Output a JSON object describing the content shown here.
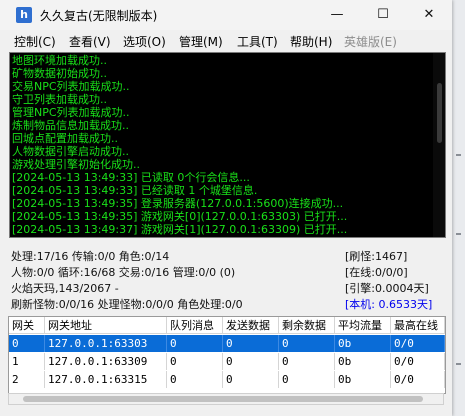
{
  "window": {
    "title": "久久复古(无限制版本)",
    "icon_letter": "h",
    "minimize_glyph": "—",
    "maximize_glyph": "☐",
    "close_glyph": "✕"
  },
  "menu": [
    {
      "label": "控制(C)",
      "enabled": true
    },
    {
      "label": "查看(V)",
      "enabled": true
    },
    {
      "label": "选项(O)",
      "enabled": true
    },
    {
      "label": "管理(M)",
      "enabled": true
    },
    {
      "label": "工具(T)",
      "enabled": true
    },
    {
      "label": "帮助(H)",
      "enabled": true
    },
    {
      "label": "英雄版(E)",
      "enabled": false
    }
  ],
  "log": [
    "地图环境加载成功..",
    "矿物数据初始成功..",
    "交易NPC列表加载成功..",
    "守卫列表加载成功..",
    "管理NPC列表加载成功..",
    "炼制物品信息加载成功..",
    "回城点配置加载成功..",
    "人物数据引擎启动成功..",
    "游戏处理引擎初始化成功..",
    "[2024-05-13 13:49:33] 已读取 0个行会信息...",
    "[2024-05-13 13:49:33] 已经读取 1 个城堡信息.",
    "[2024-05-13 13:49:35] 登录服务器(127.0.0.1:5600)连接成功...",
    "[2024-05-13 13:49:35] 游戏网关[0](127.0.0.1:63303) 已打开...",
    "[2024-05-13 13:49:37] 游戏网关[1](127.0.0.1:63309) 已打开..."
  ],
  "stats": {
    "line1": "处理:17/16 传输:0/0 角色:0/14",
    "line2": "人物:0/0 循环:16/68 交易:0/16 管理:0/0 (0)",
    "line3": "火焰天玛,143/2067 -",
    "line4": "刷新怪物:0/0/16 处理怪物:0/0/0 角色处理:0/0",
    "right1": "[刷怪:1467]",
    "right2": "[在线:0/0/0]",
    "right3": "[引擎:0.0004天]",
    "right4": "[本机: 0.6533天]"
  },
  "grid": {
    "columns": [
      "网关",
      "网关地址",
      "队列消息",
      "发送数据",
      "剩余数据",
      "平均流量",
      "最高在线"
    ],
    "rows": [
      [
        "0",
        "127.0.0.1:63303",
        "0",
        "0",
        "0",
        "0b",
        "0/0"
      ],
      [
        "1",
        "127.0.0.1:63309",
        "0",
        "0",
        "0",
        "0b",
        "0/0"
      ],
      [
        "2",
        "127.0.0.1:63315",
        "0",
        "0",
        "0",
        "0b",
        "0/0"
      ]
    ],
    "selected_row": 0
  },
  "colors": {
    "log_text": "#19e019",
    "log_bg": "#000000",
    "selection": "#0a6cd7",
    "link": "#0000ee"
  }
}
